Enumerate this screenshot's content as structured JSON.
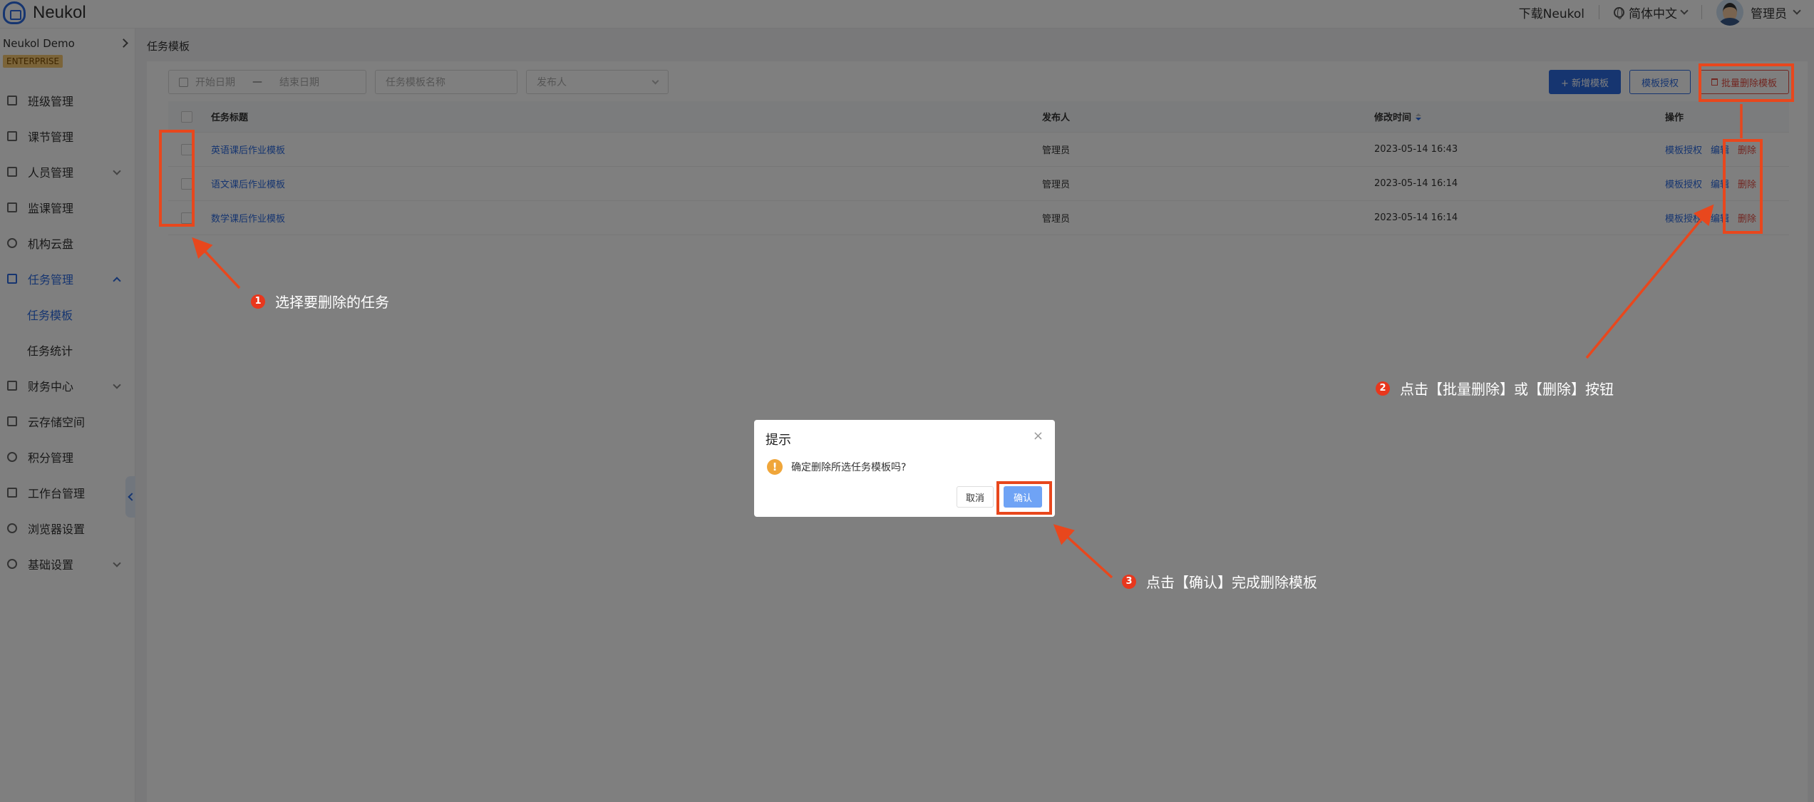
{
  "app": {
    "name": "Neukol"
  },
  "header": {
    "download": "下载Neukol",
    "language": "简体中文",
    "user": "管理员"
  },
  "sidebar": {
    "org": "Neukol Demo",
    "badge": "ENTERPRISE",
    "items": [
      {
        "label": "班级管理"
      },
      {
        "label": "课节管理"
      },
      {
        "label": "人员管理"
      },
      {
        "label": "监课管理"
      },
      {
        "label": "机构云盘"
      },
      {
        "label": "任务管理"
      },
      {
        "label": "任务模板"
      },
      {
        "label": "任务统计"
      },
      {
        "label": "财务中心"
      },
      {
        "label": "云存储空间"
      },
      {
        "label": "积分管理"
      },
      {
        "label": "工作台管理"
      },
      {
        "label": "浏览器设置"
      },
      {
        "label": "基础设置"
      }
    ]
  },
  "breadcrumb": "任务模板",
  "filters": {
    "start_date": "开始日期",
    "separator": "—",
    "end_date": "结束日期",
    "name_placeholder": "任务模板名称",
    "publisher_placeholder": "发布人"
  },
  "toolbar": {
    "add": "+ 新增模板",
    "auth": "模板授权",
    "batch_delete": "批量删除模板"
  },
  "table": {
    "headers": {
      "title": "任务标题",
      "publisher": "发布人",
      "modified": "修改时间",
      "ops": "操作"
    },
    "rows": [
      {
        "title": "英语课后作业模板",
        "publisher": "管理员",
        "modified": "2023-05-14 16:43"
      },
      {
        "title": "语文课后作业模板",
        "publisher": "管理员",
        "modified": "2023-05-14 16:14"
      },
      {
        "title": "数学课后作业模板",
        "publisher": "管理员",
        "modified": "2023-05-14 16:14"
      }
    ],
    "ops": {
      "auth": "模板授权",
      "edit": "编辑",
      "delete": "删除"
    }
  },
  "dialog": {
    "title": "提示",
    "close": "×",
    "message": "确定删除所选任务模板吗?",
    "warn": "!",
    "cancel": "取消",
    "confirm": "确认"
  },
  "callouts": [
    {
      "num": "1",
      "text": "选择要删除的任务"
    },
    {
      "num": "2",
      "text": "点击【批量删除】或【删除】按钮"
    },
    {
      "num": "3",
      "text": "点击【确认】完成删除模板"
    }
  ],
  "colors": {
    "primary": "#2d6be0",
    "danger": "#e54d42",
    "highlight": "#e8471d"
  }
}
